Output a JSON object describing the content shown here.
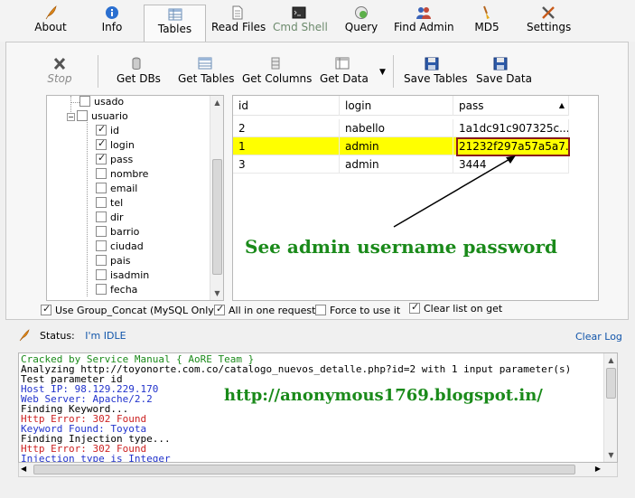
{
  "menu": {
    "items": [
      {
        "label": "About",
        "icon": "feather-icon"
      },
      {
        "label": "Info",
        "icon": "info-icon"
      },
      {
        "label": "Tables",
        "icon": "table-icon",
        "active": true
      },
      {
        "label": "Read Files",
        "icon": "document-icon"
      },
      {
        "label": "Cmd Shell",
        "icon": "terminal-icon",
        "disabled": true
      },
      {
        "label": "Query",
        "icon": "query-icon"
      },
      {
        "label": "Find Admin",
        "icon": "users-icon"
      },
      {
        "label": "MD5",
        "icon": "brush-icon"
      },
      {
        "label": "Settings",
        "icon": "tools-icon"
      }
    ]
  },
  "toolbar": {
    "stop": "Stop",
    "get_dbs": "Get DBs",
    "get_tables": "Get Tables",
    "get_columns": "Get Columns",
    "get_data": "Get Data",
    "save_tables": "Save Tables",
    "save_data": "Save Data"
  },
  "tree": {
    "items": [
      {
        "label": "usado",
        "checked": false
      },
      {
        "label": "usuario",
        "checked": false,
        "expanded": true
      },
      {
        "label": "id",
        "checked": true
      },
      {
        "label": "login",
        "checked": true
      },
      {
        "label": "pass",
        "checked": true
      },
      {
        "label": "nombre",
        "checked": false
      },
      {
        "label": "email",
        "checked": false
      },
      {
        "label": "tel",
        "checked": false
      },
      {
        "label": "dir",
        "checked": false
      },
      {
        "label": "barrio",
        "checked": false
      },
      {
        "label": "ciudad",
        "checked": false
      },
      {
        "label": "pais",
        "checked": false
      },
      {
        "label": "isadmin",
        "checked": false
      },
      {
        "label": "fecha",
        "checked": false
      }
    ]
  },
  "grid": {
    "columns": [
      "id",
      "login",
      "pass"
    ],
    "rows": [
      [
        "2",
        "nabello",
        "1a1dc91c907325c..."
      ],
      [
        "1",
        "admin",
        "21232f297a57a5a7..."
      ],
      [
        "3",
        "admin",
        "3444"
      ]
    ],
    "selected_row": 1
  },
  "options": {
    "group_concat": "Use Group_Concat (MySQL Only)",
    "all_in_one": "All in one request.",
    "force": "Force to use it",
    "clear_list": "Clear list on get"
  },
  "annotation": "See admin username password",
  "status": {
    "label": "Status:",
    "value": "I'm IDLE",
    "clear_log": "Clear Log"
  },
  "log": {
    "lines": [
      {
        "text": "Cracked by Service Manual { AoRE Team }",
        "color": "#1a8a1a"
      },
      {
        "text": "Analyzing http://toyonorte.com.co/catalogo_nuevos_detalle.php?id=2 with 1 input parameter(s)",
        "color": "#000000"
      },
      {
        "text": "Test parameter id",
        "color": "#000000"
      },
      {
        "text": "Host IP: 98.129.229.170",
        "color": "#2233cc"
      },
      {
        "text": "Web Server: Apache/2.2",
        "color": "#2233cc"
      },
      {
        "text": "Finding Keyword...",
        "color": "#000000"
      },
      {
        "text": "Http Error: 302 Found",
        "color": "#cc2222"
      },
      {
        "text": "Keyword Found: Toyota",
        "color": "#2233cc"
      },
      {
        "text": "Finding Injection type...",
        "color": "#000000"
      },
      {
        "text": "Http Error: 302 Found",
        "color": "#cc2222"
      },
      {
        "text": "Injection type is Integer",
        "color": "#2233cc"
      }
    ]
  },
  "watermark": "http://anonymous1769.blogspot.in/",
  "colors": {
    "selected_row": "#ffff00",
    "highlight_box": "#8b1a1a",
    "annotation": "#1a8a1a",
    "link": "#1155aa"
  }
}
